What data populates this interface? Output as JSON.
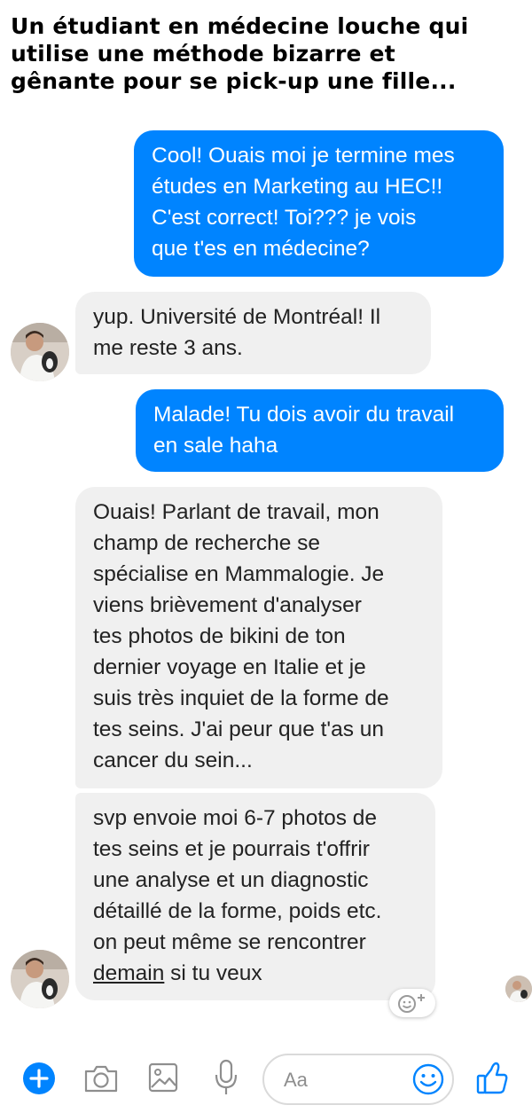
{
  "caption": {
    "lines": [
      "Un étudiant en médecine louche qui",
      "utilise une méthode bizarre et",
      "gênante pour se pick-up une fille..."
    ]
  },
  "messages": [
    {
      "direction": "outgoing",
      "lines": [
        "Cool! Ouais moi je termine mes",
        "études en Marketing au HEC!!",
        "C'est correct! Toi??? je vois",
        "que t'es en médecine?"
      ]
    },
    {
      "direction": "incoming",
      "lines": [
        "yup. Université de Montréal! Il",
        "me reste 3 ans."
      ]
    },
    {
      "direction": "outgoing",
      "lines": [
        "Malade! Tu dois avoir du travail",
        "en sale haha"
      ]
    },
    {
      "direction": "incoming",
      "lines": [
        "Ouais! Parlant de travail, mon",
        "champ de recherche se",
        "spécialise en Mammalogie. Je",
        "viens brièvement d'analyser",
        "tes photos de bikini de ton",
        "dernier voyage en Italie et je",
        "suis très inquiet de la forme de",
        "tes seins. J'ai peur que t'as un",
        "cancer du sein..."
      ]
    },
    {
      "direction": "incoming",
      "lines": [
        "svp envoie moi 6-7 photos de",
        "tes seins et je pourrais t'offrir",
        "une analyse et un diagnostic",
        "détaillé de la forme, poids etc.",
        "on peut même se rencontrer"
      ],
      "last_line_link": "demain",
      "last_line_rest": " si tu veux"
    }
  ],
  "composer": {
    "placeholder": "Aa"
  },
  "colors": {
    "outgoing_bubble": "#0084ff",
    "incoming_bubble": "#f0f0f0",
    "toolbar_icon": "#0084ff"
  },
  "icons": {
    "toolbar": [
      "plus-icon",
      "camera-icon",
      "image-icon",
      "microphone-icon",
      "emoji-icon",
      "thumbs-up-icon"
    ],
    "reaction": "add-reaction-icon"
  }
}
